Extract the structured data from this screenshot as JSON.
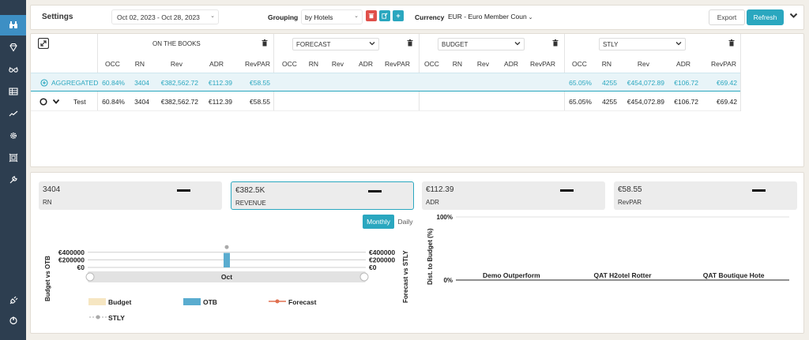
{
  "sidebar": {
    "icons": [
      "binoculars-icon",
      "diamond-icon",
      "glasses-icon",
      "table-icon",
      "trend-icon",
      "gear-icon",
      "frame-icon",
      "wrench-icon",
      "plug-icon",
      "power-icon"
    ]
  },
  "toolbar": {
    "title": "Settings",
    "date_range": "Oct 02, 2023 - Oct 28, 2023",
    "grouping_label": "Grouping",
    "grouping_value": "by Hotels",
    "currency_label": "Currency",
    "currency_value": "EUR - Euro Member Coun",
    "export_label": "Export",
    "refresh_label": "Refresh"
  },
  "table": {
    "groups": {
      "on_the_books": "ON THE BOOKS",
      "forecast": "FORECAST",
      "budget": "BUDGET",
      "stly": "STLY"
    },
    "columns": [
      "OCC",
      "RN",
      "Rev",
      "ADR",
      "RevPAR"
    ],
    "rows": {
      "aggregated": {
        "label": "AGGREGATED",
        "otb": [
          "60.84%",
          "3404",
          "€382,562.72",
          "€112.39",
          "€58.55"
        ],
        "stly": [
          "65.05%",
          "4255",
          "€454,072.89",
          "€106.72",
          "€69.42"
        ]
      },
      "test": {
        "label": "Test",
        "otb": [
          "60.84%",
          "3404",
          "€382,562.72",
          "€112.39",
          "€58.55"
        ],
        "stly": [
          "65.05%",
          "4255",
          "€454,072.89",
          "€106.72",
          "€69.42"
        ]
      }
    }
  },
  "kpis": [
    {
      "value": "3404",
      "label": "RN"
    },
    {
      "value": "€382.5K",
      "label": "REVENUE"
    },
    {
      "value": "€112.39",
      "label": "ADR"
    },
    {
      "value": "€58.55",
      "label": "RevPAR"
    }
  ],
  "chart_toggle": {
    "monthly": "Monthly",
    "daily": "Daily"
  },
  "colors": {
    "accent": "#2aa7bf",
    "budget": "#f6e6c2",
    "otb": "#5aaccf",
    "forecast": "#e07050",
    "stly": "#aaaaaa"
  },
  "chart_data": [
    {
      "type": "bar",
      "categories": [
        "Oct"
      ],
      "series": [
        {
          "name": "Budget",
          "values": [
            0
          ]
        },
        {
          "name": "OTB",
          "values": [
            382562.72
          ]
        },
        {
          "name": "Forecast",
          "values": [
            0
          ]
        },
        {
          "name": "STLY",
          "values": [
            454072.89
          ]
        }
      ],
      "ylabel": "Budget vs OTB",
      "y2label": "Forecast vs STLY",
      "yticks": [
        "€400000",
        "€200000",
        "€0"
      ],
      "y2ticks": [
        "€400000",
        "€200000",
        "€0"
      ],
      "ylim": [
        0,
        500000
      ],
      "legend_position": "bottom"
    },
    {
      "type": "bar",
      "categories": [
        "Demo Outperform",
        "QAT H2otel Rotter",
        "QAT Boutique Hote"
      ],
      "values": [
        0,
        0,
        0
      ],
      "ylabel": "Dist. to Budget (%)",
      "yticks": [
        "100%",
        "0%"
      ],
      "ylim": [
        0,
        100
      ]
    }
  ]
}
